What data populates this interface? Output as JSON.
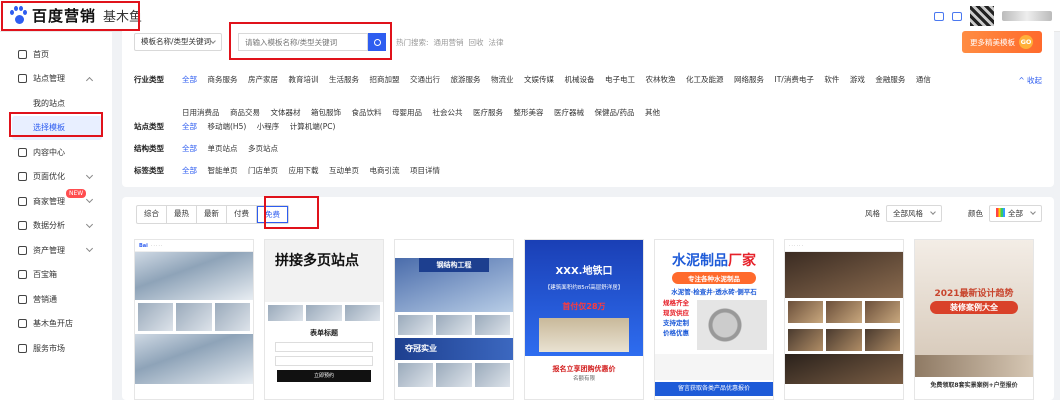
{
  "brand": {
    "name": "百度营销",
    "sub": "基木鱼"
  },
  "sidebar": {
    "items": [
      {
        "label": "首页",
        "icon": "home-icon"
      },
      {
        "label": "站点管理",
        "icon": "grid-icon",
        "expanded": true
      },
      {
        "label": "我的站点",
        "sub": true
      },
      {
        "label": "选择模板",
        "sub": true,
        "active": true
      },
      {
        "label": "内容中心",
        "icon": "content-icon"
      },
      {
        "label": "页面优化",
        "icon": "optimize-icon",
        "chevron": true
      },
      {
        "label": "商家管理",
        "icon": "shop-icon",
        "chevron": true,
        "badge": "NEW"
      },
      {
        "label": "数据分析",
        "icon": "chart-icon",
        "chevron": true
      },
      {
        "label": "资产管理",
        "icon": "asset-icon",
        "chevron": true
      },
      {
        "label": "百宝箱",
        "icon": "toolbox-icon"
      },
      {
        "label": "营销通",
        "icon": "link-icon"
      },
      {
        "label": "基木鱼开店",
        "icon": "store-icon"
      },
      {
        "label": "服务市场",
        "icon": "market-icon"
      }
    ]
  },
  "search": {
    "select_label": "模板名称/类型关键词",
    "placeholder": "请输入模板名称/类型关键词",
    "hot_label": "热门搜索:",
    "hot_terms": [
      "通用营销",
      "回收",
      "法律"
    ],
    "more_label": "更多精美模板",
    "more_badge": "GO"
  },
  "filters": {
    "industry_label": "行业类型",
    "industry_row1": [
      "全部",
      "商务服务",
      "房产家居",
      "教育培训",
      "生活服务",
      "招商加盟",
      "交通出行",
      "旅游服务",
      "物流业",
      "文娱传媒",
      "机械设备",
      "电子电工",
      "农林牧渔",
      "化工及能源",
      "网络服务",
      "IT/消费电子",
      "软件",
      "游戏",
      "金融服务",
      "通信"
    ],
    "industry_row2": [
      "日用消费品",
      "商品交易",
      "文体器材",
      "箱包服饰",
      "食品饮料",
      "母婴用品",
      "社会公共",
      "医疗服务",
      "整形美容",
      "医疗器械",
      "保健品/药品",
      "其他"
    ],
    "collapse_label": "^ 收起",
    "site_label": "站点类型",
    "site_opts": [
      "全部",
      "移动端(H5)",
      "小程序",
      "计算机端(PC)"
    ],
    "struct_label": "结构类型",
    "struct_opts": [
      "全部",
      "单页站点",
      "多页站点"
    ],
    "tag_label": "标签类型",
    "tag_opts": [
      "全部",
      "智能单页",
      "门店单页",
      "应用下载",
      "互动单页",
      "电商引流",
      "项目详情"
    ]
  },
  "sort": {
    "tabs": [
      "综合",
      "最热",
      "最新",
      "付费",
      "免费"
    ],
    "style_label": "风格",
    "style_value": "全部风格",
    "color_label": "颜色",
    "color_value": "全部"
  },
  "templates": {
    "t2_title": "拼接多页站点",
    "t2_form": "表单标题",
    "t2_btn": "立即预约",
    "t3_title": "钢结构工程",
    "t3_band": "夺冠实业",
    "t4_title": "XXX.地铁口",
    "t4_sub": "【建筑面积约85㎡高层舒洋居】",
    "t4_price": "首付仅28万",
    "t4_cta": "报名立享团购优惠价",
    "t4_cta2": "名额有限",
    "t5_title1": "水泥制品",
    "t5_title2": "厂家",
    "t5_sub": "专注各种水泥制品",
    "t5_products": "水泥管·检查井·透水砖·侧平石",
    "t5_features": [
      "规格齐全",
      "现货供应",
      "支持定制",
      "价格优惠"
    ],
    "t5_footer": "留言获取各类产品优惠报价",
    "t7_year": "2021最新设计趋势",
    "t7_sub": "装修案例大全",
    "t7_footer": "免费领取8套实景案例+户型报价"
  },
  "colors": {
    "accent": "#2e5df0",
    "highlight": "#e0121b",
    "cta": "#ff6a2c"
  }
}
